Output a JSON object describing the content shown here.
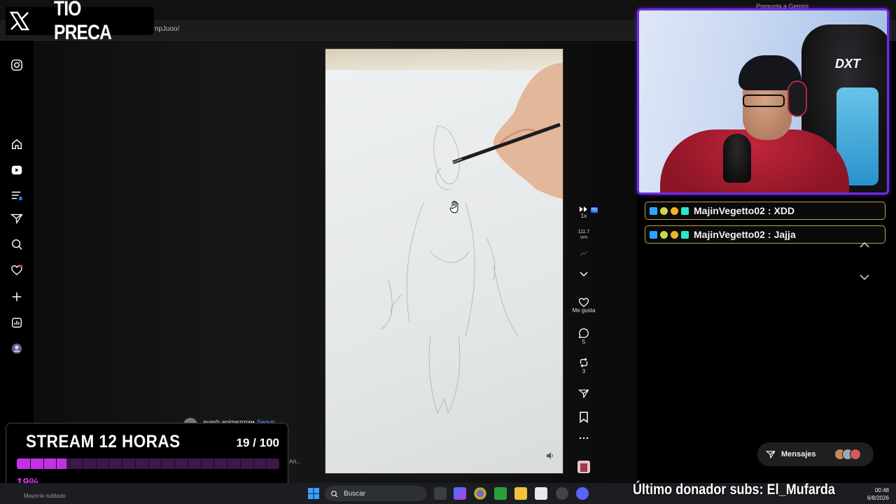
{
  "browser": {
    "tab_title": "Instagram",
    "url_fragment": "mpJuoo/",
    "gemini_button": "Pregunta a Gemini"
  },
  "brand": {
    "name": "TIO PRECA",
    "logo_icon": "x-logo-icon"
  },
  "sidebar": {
    "items": [
      {
        "name": "instagram-icon"
      },
      {
        "name": "home-icon"
      },
      {
        "name": "reels-icon"
      },
      {
        "name": "feed-filter-icon"
      },
      {
        "name": "send-icon"
      },
      {
        "name": "search-icon"
      },
      {
        "name": "notifications-icon"
      },
      {
        "name": "create-icon"
      },
      {
        "name": "insights-icon"
      },
      {
        "name": "profile-avatar"
      }
    ]
  },
  "actions": {
    "speed_label": "1x",
    "hq_badge": "HQ",
    "vph_value": "111.7",
    "vph_label": "VPH",
    "like_label": "Me gusta",
    "comments_count": "5",
    "reposts_count": "3"
  },
  "post": {
    "author": "ayash.animezone",
    "separator": " • ",
    "follow": "Seguir",
    "side_text": "Art..."
  },
  "chat": {
    "messages": [
      {
        "user": "MajinVegetto02",
        "text": "XDD"
      },
      {
        "user": "MajinVegetto02",
        "text": "Jajja"
      }
    ]
  },
  "messages_button": {
    "label": "Mensajes"
  },
  "goal": {
    "title": "STREAM 12 HORAS",
    "count": "19 / 100",
    "percent_label": "19%",
    "progress": 0.19,
    "fill_color": "#c232e4",
    "track_color": "#3b1948"
  },
  "taskbar": {
    "search_placeholder": "Buscar",
    "time": "00:48",
    "date": "6/8/2026",
    "left_text": "Mayoría nublado"
  },
  "donor_ticker": "Último donador subs: El_Mufarda",
  "colors": {
    "webcam_border": "#6f2de0",
    "chat_border": "#b8a14a",
    "accent_blue": "#5ea0ff"
  }
}
